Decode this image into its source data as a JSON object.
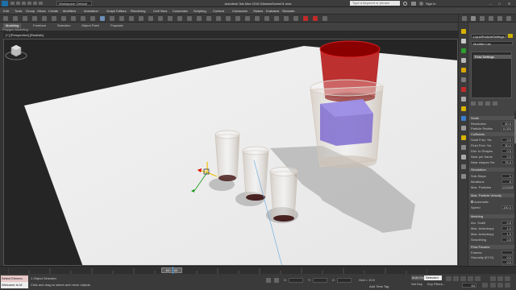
{
  "window": {
    "title": "Autodesk 3ds Max 2016   GlassesScene01.max",
    "workspace": "Workspace: Default",
    "search_placeholder": "Type a keyword or phrase",
    "sign_in": "Sign In"
  },
  "menu": [
    "Edit",
    "Tools",
    "Group",
    "Views",
    "Create",
    "Modifiers",
    "Animation",
    "Graph Editors",
    "Rendering",
    "Civil View",
    "Customize",
    "Scripting",
    "Content",
    "Corkscrew",
    "Stokes",
    "Krakatoa",
    "Simulate"
  ],
  "ribbon": {
    "tabs": [
      "Modeling",
      "Freeform",
      "Selection",
      "Object Paint",
      "Populate"
    ],
    "active_tab": "Modeling",
    "subtitle": "Polygon Modeling"
  },
  "viewport": {
    "label": "[+] [Perspective] [Realistic]"
  },
  "command_panel": {
    "object_name": "LiquidParticleSettings",
    "modifier_list": "Modifier List",
    "stack_item": "Flow Settings",
    "rollouts": {
      "scale": "Scale",
      "collisions": "Collisions",
      "simulation": "Simulation",
      "max_particle_velocity": "Max. Particle Velocity",
      "meshing": "Meshing",
      "flow_params": "Flow Params"
    },
    "scale_params": [
      {
        "label": "Resolution",
        "value": "40.0"
      },
      {
        "label": "Particle Radius",
        "value": "0.025"
      }
    ],
    "collision_params": [
      {
        "label": "Solid Frict. %s",
        "value": "0.0"
      },
      {
        "label": "Fluid Frict. %s",
        "value": "20.0"
      },
      {
        "label": "Dist. to Shapes",
        "value": "0.5"
      },
      {
        "label": "Near per frame",
        "value": "0.0"
      },
      {
        "label": "Near shapes %s",
        "value": "75.0"
      }
    ],
    "simulation_params": [
      {
        "label": "Sub-Steps",
        "value": "1"
      },
      {
        "label": "Iterations",
        "value": "8"
      },
      {
        "label": "Max. Particles",
        "value": "100000"
      }
    ],
    "velocity": {
      "automatic_label": "Automatic",
      "speed_label": "Speed",
      "speed_value": "100.0"
    },
    "meshing_params": [
      {
        "label": "Arc. Scale",
        "value": "0.5"
      },
      {
        "label": "Max. Anisotropy",
        "value": "1.0"
      },
      {
        "label": "Max. Anisotropy",
        "value": "1.0"
      },
      {
        "label": "Smoothing",
        "value": "0.5"
      }
    ],
    "flow_params": [
      {
        "label": "Frames",
        "value": ""
      },
      {
        "label": "Viscosity (ECO)",
        "value": "0.0"
      },
      {
        "label": "",
        "value": "0.0"
      },
      {
        "label": "Wind (ECO)",
        "value": "0.0"
      },
      {
        "label": "",
        "value": "0.0"
      },
      {
        "label": "",
        "value": "0.0"
      }
    ]
  },
  "timeline": {
    "slider_label": "63 / 100"
  },
  "status": {
    "maxscript_1": "Select Elemen",
    "maxscript_2": "Welcome to M",
    "selected": "1 Object Selected",
    "prompt": "Click and drag to select and move objects",
    "grid": "Grid = 10.0",
    "add_time_tag": "Add Time Tag",
    "auto_key": "Auto Key",
    "selected_dropdown": "Selected",
    "set_key": "Set Key",
    "key_filters": "Key Filters...",
    "current_frame": "63",
    "coord_labels": [
      "X:",
      "Y:",
      "Z:"
    ]
  },
  "colors": {
    "accent_red": "#c42a2a",
    "viewport_bg": "#252525",
    "liquid": "#7f6cd0"
  }
}
